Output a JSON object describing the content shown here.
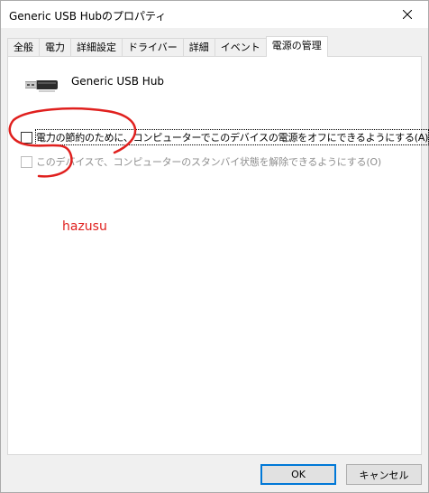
{
  "window": {
    "title": "Generic USB Hubのプロパティ"
  },
  "tabs": [
    {
      "label": "全般",
      "active": false
    },
    {
      "label": "電力",
      "active": false
    },
    {
      "label": "詳細設定",
      "active": false
    },
    {
      "label": "ドライバー",
      "active": false
    },
    {
      "label": "詳細",
      "active": false
    },
    {
      "label": "イベント",
      "active": false
    },
    {
      "label": "電源の管理",
      "active": true
    }
  ],
  "device": {
    "name": "Generic USB Hub",
    "icon": "usb-connector-icon"
  },
  "options": {
    "allow_power_off": {
      "label": "電力の節約のために、コンピューターでこのデバイスの電源をオフにできるようにする(A)",
      "checked": false,
      "enabled": true
    },
    "allow_wake": {
      "label": "このデバイスで、コンピューターのスタンバイ状態を解除できるようにする(O)",
      "checked": false,
      "enabled": false
    }
  },
  "annotation": {
    "text": "hazusu",
    "color": "#e0201e"
  },
  "buttons": {
    "ok": "OK",
    "cancel": "キャンセル"
  }
}
